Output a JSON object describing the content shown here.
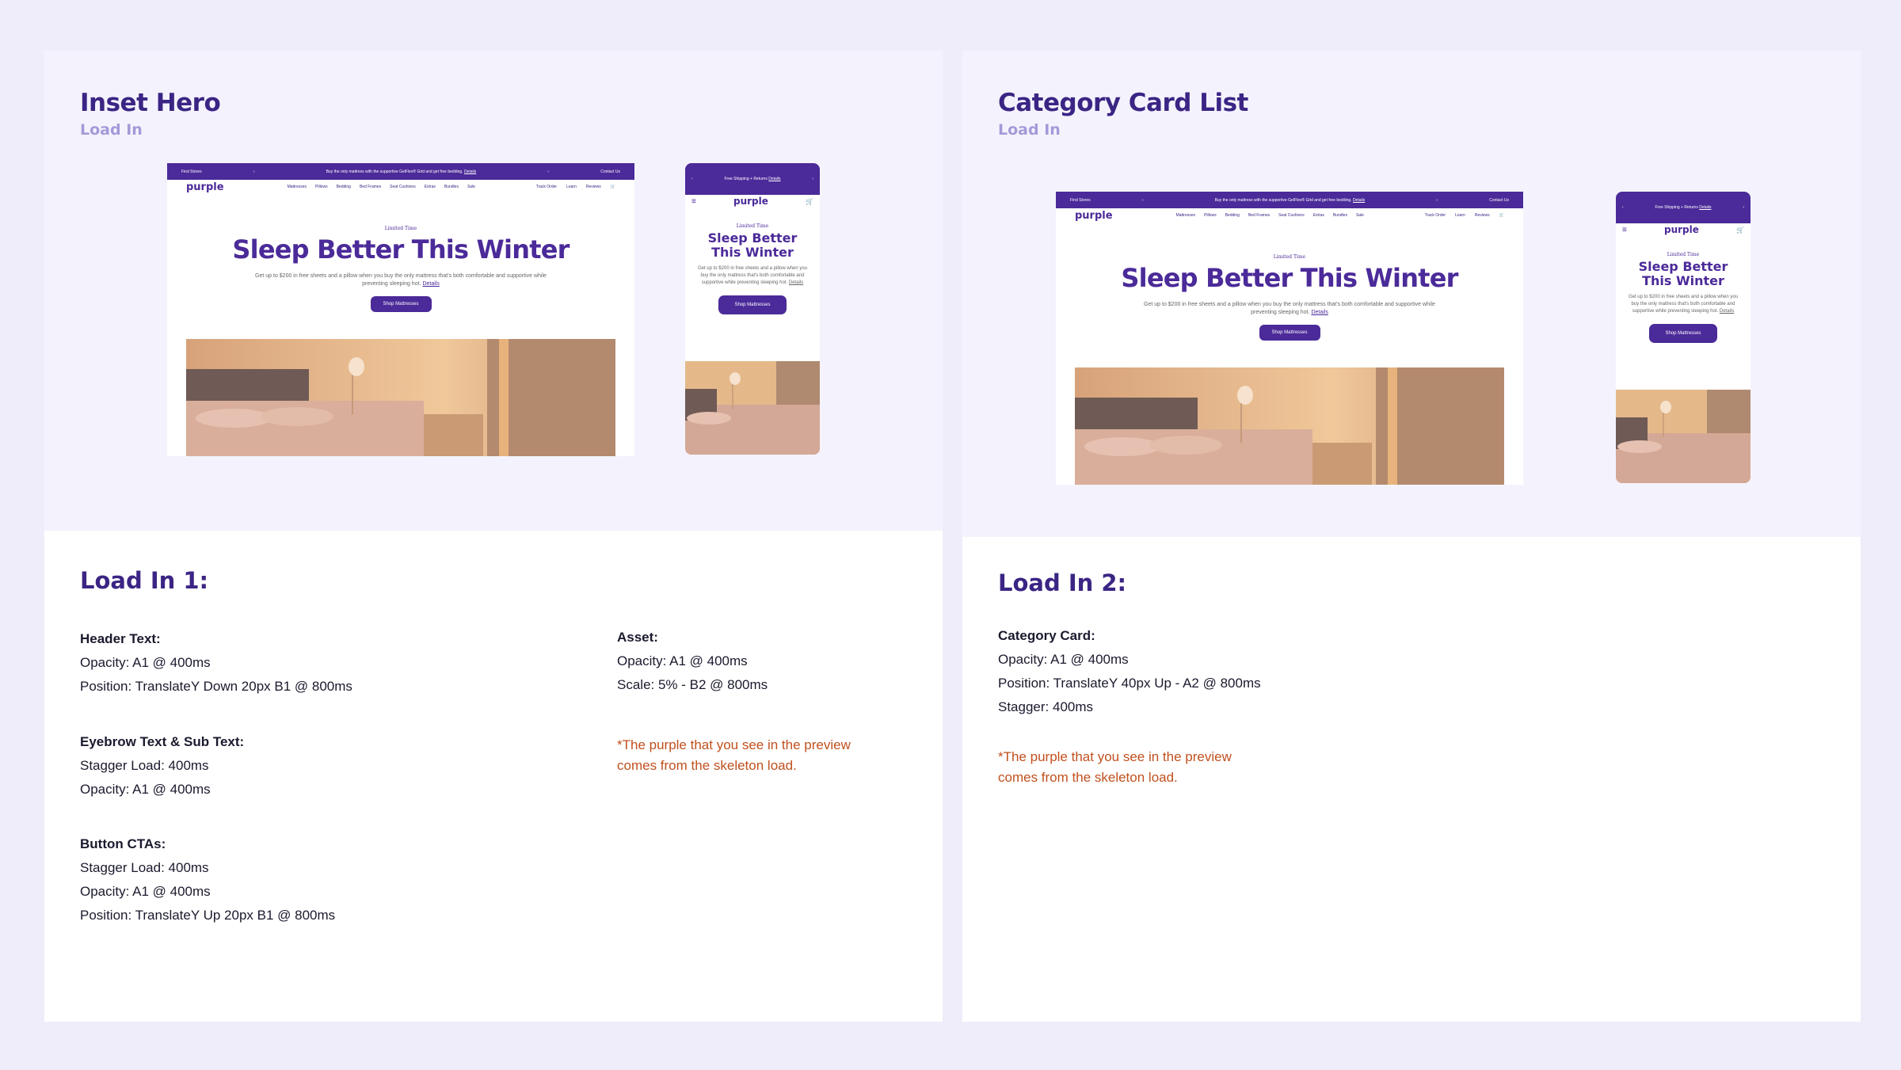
{
  "colors": {
    "page_bg": "#efedfa",
    "brand_purple": "#4b2a99",
    "heading_purple": "#3b2584",
    "subtitle_lavender": "#a49ad8",
    "note_orange": "#c0501e"
  },
  "mock": {
    "desktop": {
      "bar_left": "Find Stores",
      "bar_center": "Buy the only mattress with the supportive GelFlex® Grid and get free bedding.",
      "bar_center_link": "Details",
      "bar_right": "Contact Us",
      "logo": "purple",
      "nav_links": [
        "Mattresses",
        "Pillows",
        "Bedding",
        "Bed Frames",
        "Seat Cushions",
        "Extras",
        "Bundles",
        "Sale"
      ],
      "nav_right": [
        "Track Order",
        "Learn",
        "Reviews"
      ],
      "eyebrow": "Limited Time",
      "headline": "Sleep Better This Winter",
      "subtext": "Get up to $200 in free sheets and a pillow when you buy the only mattress that's both comfortable and supportive while preventing sleeping hot.",
      "subtext_link": "Details",
      "cta": "Shop Mattresses"
    },
    "mobile": {
      "bar_text": "Free Shipping + Returns",
      "bar_link": "Details",
      "logo": "purple",
      "eyebrow": "Limited Time",
      "headline": "Sleep Better This Winter",
      "subtext": "Get up to $200 in free sheets and a pillow when you buy the only mattress that's both comfortable and supportive while preventing sleeping hot.",
      "subtext_link": "Details",
      "cta": "Shop Mattresses"
    }
  },
  "left": {
    "title": "Inset Hero",
    "subtitle": "Load In",
    "section_title": "Load In 1:",
    "header_text": {
      "heading": "Header Text:",
      "lines": [
        "Opacity: A1 @ 400ms",
        "Position: TranslateY Down 20px B1 @ 800ms"
      ]
    },
    "eyebrow_text": {
      "heading": "Eyebrow Text & Sub Text:",
      "lines": [
        "Stagger Load: 400ms",
        "Opacity: A1 @ 400ms"
      ]
    },
    "button_ctas": {
      "heading": "Button CTAs:",
      "lines": [
        "Stagger Load: 400ms",
        "Opacity: A1 @ 400ms",
        "Position: TranslateY Up 20px  B1 @ 800ms"
      ]
    },
    "asset": {
      "heading": "Asset:",
      "lines": [
        "Opacity: A1 @ 400ms",
        "Scale: 5%  - B2  @ 800ms"
      ]
    },
    "warning": [
      "*The purple that you see in the preview",
      "comes from the skeleton load."
    ]
  },
  "right": {
    "title": "Category Card List",
    "subtitle": "Load In",
    "section_title": "Load In 2:",
    "category_card": {
      "heading": "Category Card:",
      "lines": [
        "Opacity: A1 @ 400ms",
        "Position: TranslateY 40px  Up  - A2 @ 800ms",
        "Stagger: 400ms"
      ]
    },
    "warning": [
      "*The purple that you see in the preview",
      "comes from the skeleton load."
    ]
  }
}
